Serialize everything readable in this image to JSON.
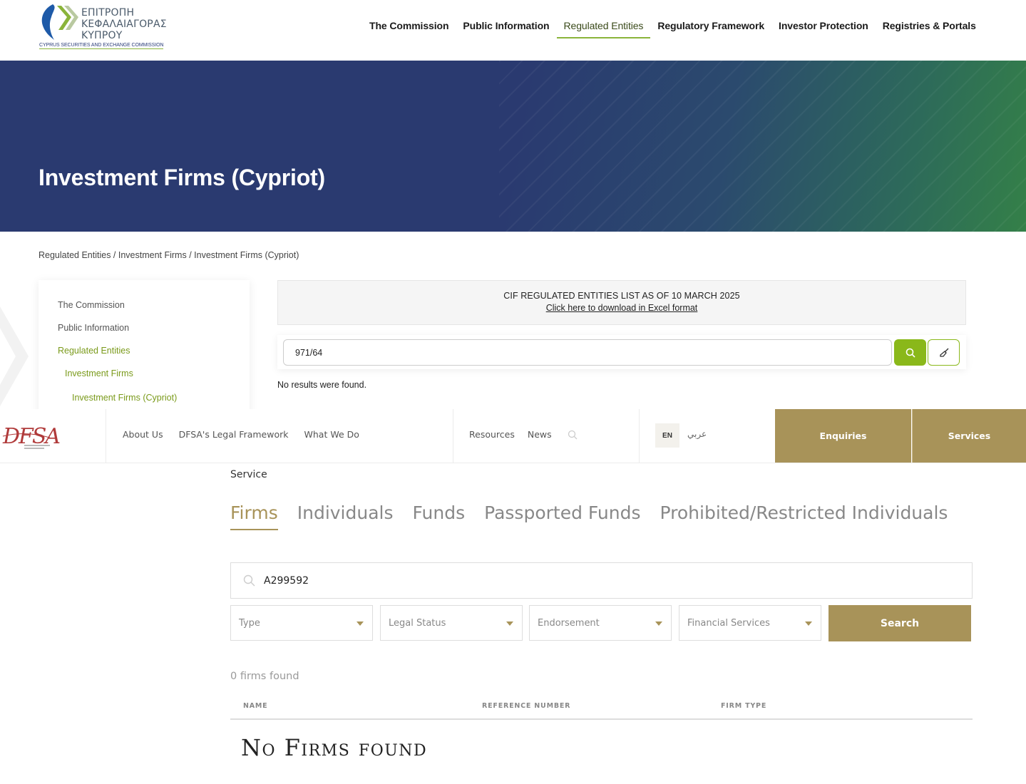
{
  "cysec": {
    "logo": {
      "greek_line1": "ΕΠΙΤΡΟΠΗ",
      "greek_line2": "ΚΕΦΑΛΑΙΑΓΟΡΑΣ",
      "greek_line3": "ΚΥΠΡΟΥ",
      "english": "CYPRUS SECURITIES AND EXCHANGE COMMISSION"
    },
    "nav": [
      {
        "label": "The Commission"
      },
      {
        "label": "Public Information"
      },
      {
        "label": "Regulated Entities",
        "active": true
      },
      {
        "label": "Regulatory Framework"
      },
      {
        "label": "Investor Protection"
      },
      {
        "label": "Registries & Portals"
      }
    ],
    "hero_title": "Investment Firms (Cypriot)",
    "breadcrumb": "Regulated Entities / Investment Firms / Investment Firms (Cypriot)",
    "sidebar": [
      {
        "label": "The Commission"
      },
      {
        "label": "Public Information"
      },
      {
        "label": "Regulated Entities"
      },
      {
        "label": "Investment Firms"
      },
      {
        "label": "Investment Firms (Cypriot)"
      }
    ],
    "notice_title": "CIF REGULATED ENTITIES LIST AS OF 10 MARCH 2025",
    "notice_link": "Click here to download in Excel format",
    "search_value": "971/64",
    "no_results": "No results were found.",
    "colors": {
      "accent": "#8ab81a",
      "hero": "#2a3a70"
    }
  },
  "dfsa": {
    "logo_text": "DFSA",
    "nav_primary": [
      {
        "label": "About Us"
      },
      {
        "label": "DFSA's Legal Framework"
      },
      {
        "label": "What We Do"
      }
    ],
    "nav_secondary": [
      {
        "label": "Resources"
      },
      {
        "label": "News"
      }
    ],
    "lang_en": "EN",
    "lang_ar": "عربي",
    "btn_enquiries": "Enquiries",
    "btn_services": "Services",
    "crumb": "Service",
    "tabs": [
      {
        "label": "Firms",
        "active": true
      },
      {
        "label": "Individuals"
      },
      {
        "label": "Funds"
      },
      {
        "label": "Passported Funds"
      },
      {
        "label": "Prohibited/Restricted Individuals"
      }
    ],
    "search_value": "A299592",
    "filters": [
      {
        "label": "Type"
      },
      {
        "label": "Legal Status"
      },
      {
        "label": "Endorsement"
      },
      {
        "label": "Financial Services"
      }
    ],
    "search_btn": "Search",
    "count": "0 firms found",
    "columns": [
      "NAME",
      "REFERENCE NUMBER",
      "FIRM TYPE"
    ],
    "empty": "No Firms found",
    "colors": {
      "accent": "#a89359"
    }
  }
}
